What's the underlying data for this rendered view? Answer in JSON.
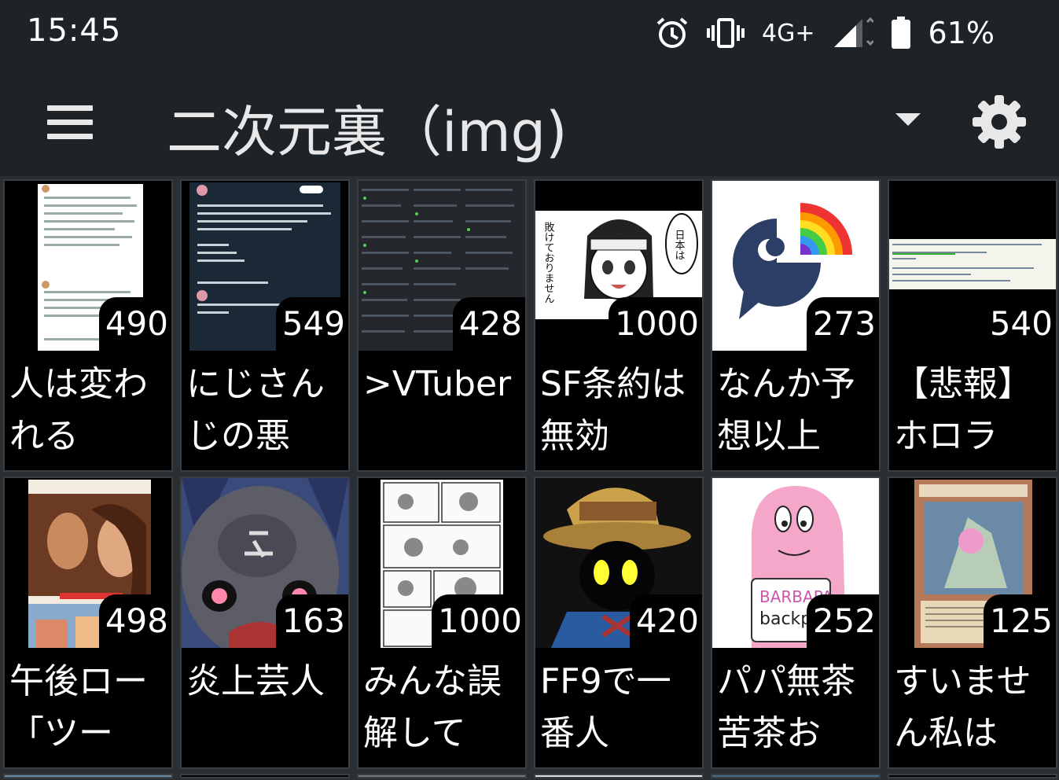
{
  "status": {
    "time": "15:45",
    "network": "4G+",
    "battery": "61%"
  },
  "appbar": {
    "title": "二次元裏（img)"
  },
  "threads": [
    {
      "count": "490",
      "title": "人は変われる"
    },
    {
      "count": "549",
      "title": "にじさんじの悪"
    },
    {
      "count": "428",
      "title": ">VTuber"
    },
    {
      "count": "1000",
      "title": "SF条約は無効"
    },
    {
      "count": "273",
      "title": "なんか予想以上"
    },
    {
      "count": "540",
      "title": "【悲報】ホロラ"
    },
    {
      "count": "498",
      "title": "午後ロー「ツー"
    },
    {
      "count": "163",
      "title": "炎上芸人"
    },
    {
      "count": "1000",
      "title": "みんな誤解して"
    },
    {
      "count": "420",
      "title": "FF9で一番人"
    },
    {
      "count": "252",
      "title": "パパ無茶苦茶お"
    },
    {
      "count": "125",
      "title": "すいません私は"
    }
  ],
  "thumb_text": {
    "t4_side": "敗けておりません",
    "t4_bubble": "日本は",
    "t11_book1": "BARBAPA",
    "t11_book2": "backpa"
  },
  "colors": {
    "background": "#1e2328",
    "cell": "#000000",
    "border": "#3a3f44"
  }
}
